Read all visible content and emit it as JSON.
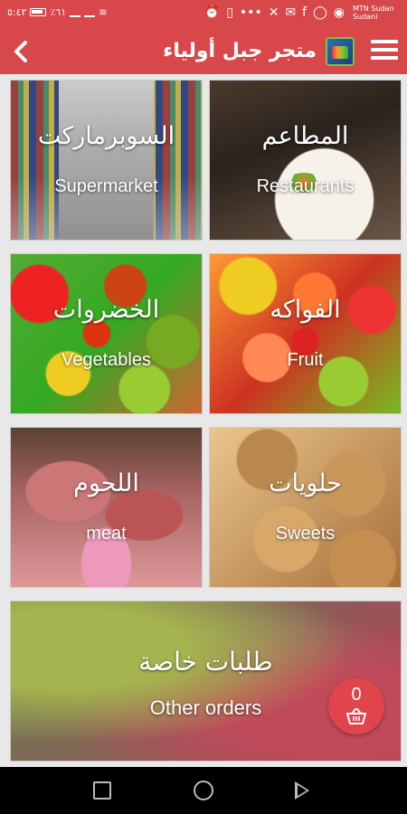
{
  "status_bar": {
    "time": "٥:٤٢",
    "battery": "٪٦١",
    "carrier_line1": "MTN Sudan",
    "carrier_line2": "Sudani"
  },
  "toolbar": {
    "title": "متجر جبل أولياء",
    "back_icon": "chevron-left-icon",
    "menu_icon": "hamburger-menu-icon"
  },
  "categories": [
    {
      "id": "supermarket",
      "label_ar": "السوبرماركت",
      "label_en": "Supermarket"
    },
    {
      "id": "restaurants",
      "label_ar": "المطاعم",
      "label_en": "Restaurants"
    },
    {
      "id": "vegetables",
      "label_ar": "الخضروات",
      "label_en": "Vegetables"
    },
    {
      "id": "fruit",
      "label_ar": "الفواكه",
      "label_en": "Fruit"
    },
    {
      "id": "meat",
      "label_ar": "اللحوم",
      "label_en": "meat"
    },
    {
      "id": "sweets",
      "label_ar": "حلويات",
      "label_en": "Sweets"
    },
    {
      "id": "other",
      "label_ar": "طلبات خاصة",
      "label_en": "Other orders"
    }
  ],
  "cart": {
    "count": "0",
    "icon": "shopping-basket-icon"
  },
  "colors": {
    "primary": "#d8474a",
    "cart": "#e0454c",
    "navbar": "#000000"
  }
}
